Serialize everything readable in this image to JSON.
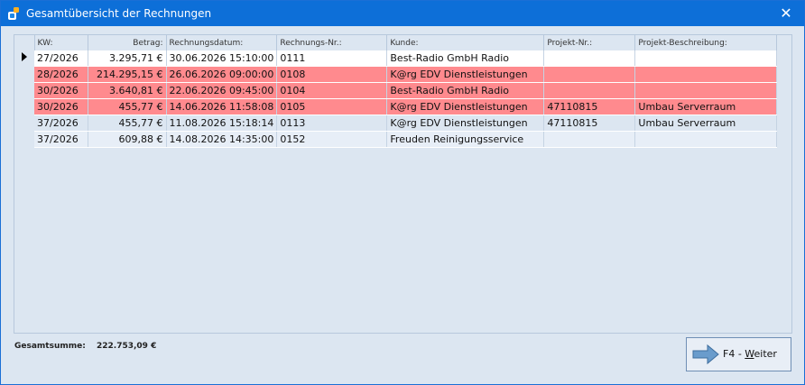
{
  "window": {
    "title": "Gesamtübersicht der Rechnungen",
    "close_glyph": "✕",
    "app_icon": "app-icon",
    "accent_color": "#0d6fd8"
  },
  "table": {
    "columns": [
      {
        "key": "kw",
        "label": "KW:"
      },
      {
        "key": "betrag",
        "label": "Betrag:"
      },
      {
        "key": "datum",
        "label": "Rechnungsdatum:"
      },
      {
        "key": "nr",
        "label": "Rechnungs-Nr.:"
      },
      {
        "key": "kunde",
        "label": "Kunde:"
      },
      {
        "key": "projekt",
        "label": "Projekt-Nr.:"
      },
      {
        "key": "beschreibung",
        "label": "Projekt-Beschreibung:"
      }
    ],
    "rows": [
      {
        "kw": "27/2026",
        "betrag": "3.295,71 €",
        "datum": "30.06.2026 15:10:00",
        "nr": "0111",
        "kunde": "Best-Radio GmbH Radio",
        "projekt": "",
        "beschreibung": "",
        "style": "white",
        "current": true
      },
      {
        "kw": "28/2026",
        "betrag": "214.295,15 €",
        "datum": "26.06.2026 09:00:00",
        "nr": "0108",
        "kunde": "K@rg EDV Dienstleistungen",
        "projekt": "",
        "beschreibung": "",
        "style": "red",
        "current": false
      },
      {
        "kw": "30/2026",
        "betrag": "3.640,81 €",
        "datum": "22.06.2026 09:45:00",
        "nr": "0104",
        "kunde": "Best-Radio GmbH Radio",
        "projekt": "",
        "beschreibung": "",
        "style": "red",
        "current": false
      },
      {
        "kw": "30/2026",
        "betrag": "455,77 €",
        "datum": "14.06.2026 11:58:08",
        "nr": "0105",
        "kunde": "K@rg EDV Dienstleistungen",
        "projekt": "47110815",
        "beschreibung": "Umbau Serverraum",
        "style": "red",
        "current": false
      },
      {
        "kw": "37/2026",
        "betrag": "455,77 €",
        "datum": "11.08.2026 15:18:14",
        "nr": "0113",
        "kunde": "K@rg EDV Dienstleistungen",
        "projekt": "47110815",
        "beschreibung": "Umbau Serverraum",
        "style": "light",
        "current": false
      },
      {
        "kw": "37/2026",
        "betrag": "609,88 €",
        "datum": "14.08.2026 14:35:00",
        "nr": "0152",
        "kunde": "Freuden Reinigungsservice",
        "projekt": "",
        "beschreibung": "",
        "style": "lighter",
        "current": false
      }
    ],
    "highlight_color": "#ff8a8e"
  },
  "footer": {
    "sum_label": "Gesamtsumme:",
    "sum_value": "222.753,09 €",
    "next_button": {
      "prefix": "F4 - ",
      "hotkey": "W",
      "rest": "eiter",
      "icon": "arrow-right-icon"
    }
  }
}
